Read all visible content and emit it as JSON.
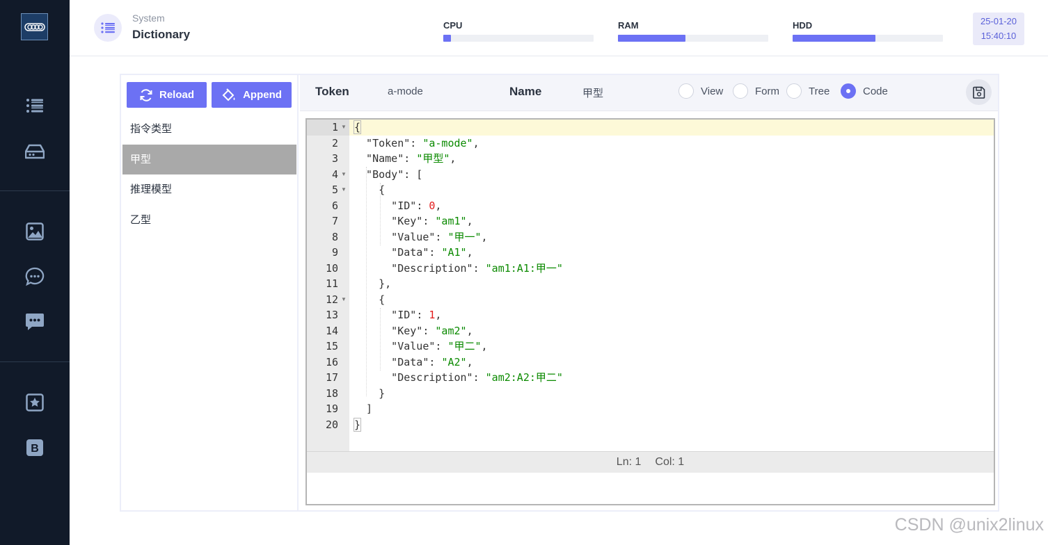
{
  "sidebar": {
    "logo": "app-logo",
    "items": [
      {
        "icon": "list-icon"
      },
      {
        "icon": "drive-icon"
      },
      {
        "icon": "image-icon"
      },
      {
        "icon": "chat-dots-icon"
      },
      {
        "icon": "message-filled-icon"
      },
      {
        "icon": "star-square-icon"
      },
      {
        "icon": "bold-b-icon"
      }
    ]
  },
  "header": {
    "subtitle": "System",
    "title": "Dictionary",
    "meters": [
      {
        "label": "CPU",
        "value": 0.05
      },
      {
        "label": "RAM",
        "value": 0.45
      },
      {
        "label": "HDD",
        "value": 0.55
      }
    ],
    "date": "25-01-20",
    "time": "15:40:10",
    "accent": "#6c71f4"
  },
  "left": {
    "reload_label": "Reload",
    "append_label": "Append",
    "items": [
      "指令类型",
      "甲型",
      "推理模型",
      "乙型"
    ],
    "selected_index": 1
  },
  "toolbar": {
    "token_label": "Token",
    "token_value": "a-mode",
    "name_label": "Name",
    "name_value": "甲型",
    "modes": [
      "View",
      "Form",
      "Tree",
      "Code"
    ],
    "selected_mode": "Code"
  },
  "editor": {
    "line_numbers": [
      "1",
      "2",
      "3",
      "4",
      "5",
      "6",
      "7",
      "8",
      "9",
      "10",
      "11",
      "12",
      "13",
      "14",
      "15",
      "16",
      "17",
      "18",
      "19",
      "20"
    ],
    "status_ln": "Ln: 1",
    "status_col": "Col: 1"
  },
  "watermark": "CSDN @unix2linux"
}
